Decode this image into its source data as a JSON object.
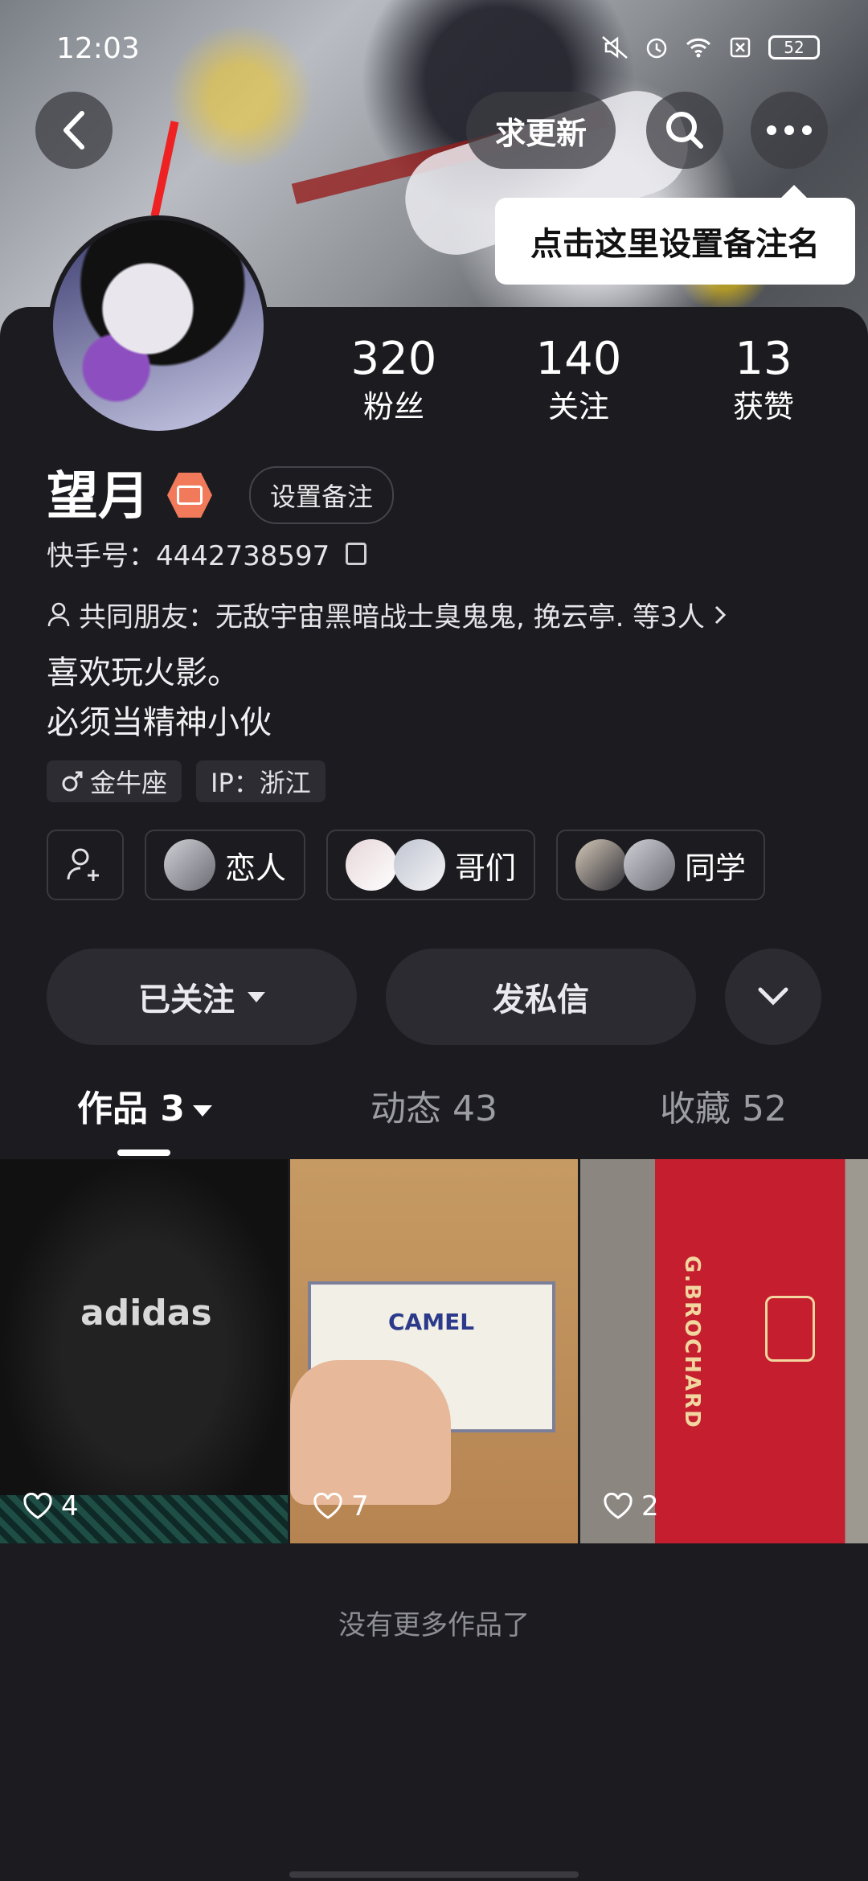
{
  "status_bar": {
    "time": "12:03",
    "battery": "52"
  },
  "nav": {
    "update_label": "求更新"
  },
  "tooltip": "点击这里设置备注名",
  "stats": [
    {
      "num": "320",
      "label": "粉丝"
    },
    {
      "num": "140",
      "label": "关注"
    },
    {
      "num": "13",
      "label": "获赞"
    }
  ],
  "profile": {
    "name": "望月",
    "remark_button": "设置备注",
    "uid": "快手号：4442738597",
    "mutual_friends": "共同朋友：无敌宇宙黑暗战士臭鬼鬼, 挽云亭. 等3人",
    "bio_line1": "喜欢玩火影。",
    "bio_line2": "必须当精神小伙",
    "tag_zodiac": "金牛座",
    "tag_ip": "IP：浙江"
  },
  "groups": [
    "恋人",
    "哥们",
    "同学"
  ],
  "actions": {
    "follow": "已关注",
    "message": "发私信"
  },
  "tabs": [
    {
      "label": "作品 3"
    },
    {
      "label": "动态 43"
    },
    {
      "label": "收藏 52"
    }
  ],
  "works": [
    {
      "likes": "4",
      "logo": "adidas"
    },
    {
      "likes": "7",
      "logo": "CAMEL"
    },
    {
      "likes": "2",
      "logo": "G.BROCHARD"
    }
  ],
  "footer_text": "没有更多作品了"
}
